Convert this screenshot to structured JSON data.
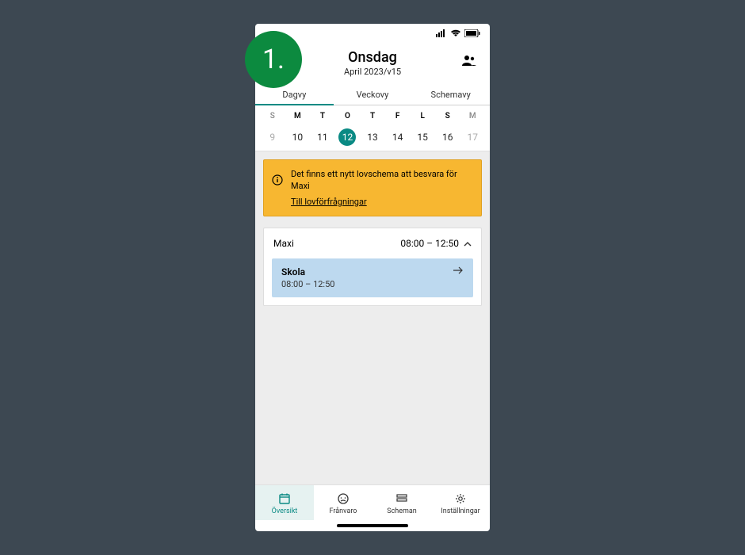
{
  "annotation_badge": "1.",
  "header": {
    "title": "Onsdag",
    "subtitle": "April 2023/v15"
  },
  "tabs": [
    {
      "label": "Dagvy",
      "active": true
    },
    {
      "label": "Veckovy",
      "active": false
    },
    {
      "label": "Schemavy",
      "active": false
    }
  ],
  "week": {
    "letters": [
      "S",
      "M",
      "T",
      "O",
      "T",
      "F",
      "L",
      "S",
      "M"
    ],
    "letter_bold": [
      false,
      true,
      true,
      true,
      true,
      true,
      true,
      true,
      false
    ],
    "dates": [
      "9",
      "10",
      "11",
      "12",
      "13",
      "14",
      "15",
      "16",
      "17"
    ],
    "date_muted": [
      true,
      false,
      false,
      false,
      false,
      false,
      false,
      false,
      true
    ],
    "selected_index": 3
  },
  "alert": {
    "text": "Det finns ett nytt lovschema att besvara för Maxi",
    "link": "Till lovförfrågningar"
  },
  "card": {
    "name": "Maxi",
    "time": "08:00 – 12:50",
    "event": {
      "title": "Skola",
      "time": "08:00 – 12:50"
    }
  },
  "nav": [
    {
      "label": "Översikt",
      "active": true
    },
    {
      "label": "Frånvaro",
      "active": false
    },
    {
      "label": "Scheman",
      "active": false
    },
    {
      "label": "Inställningar",
      "active": false
    }
  ]
}
